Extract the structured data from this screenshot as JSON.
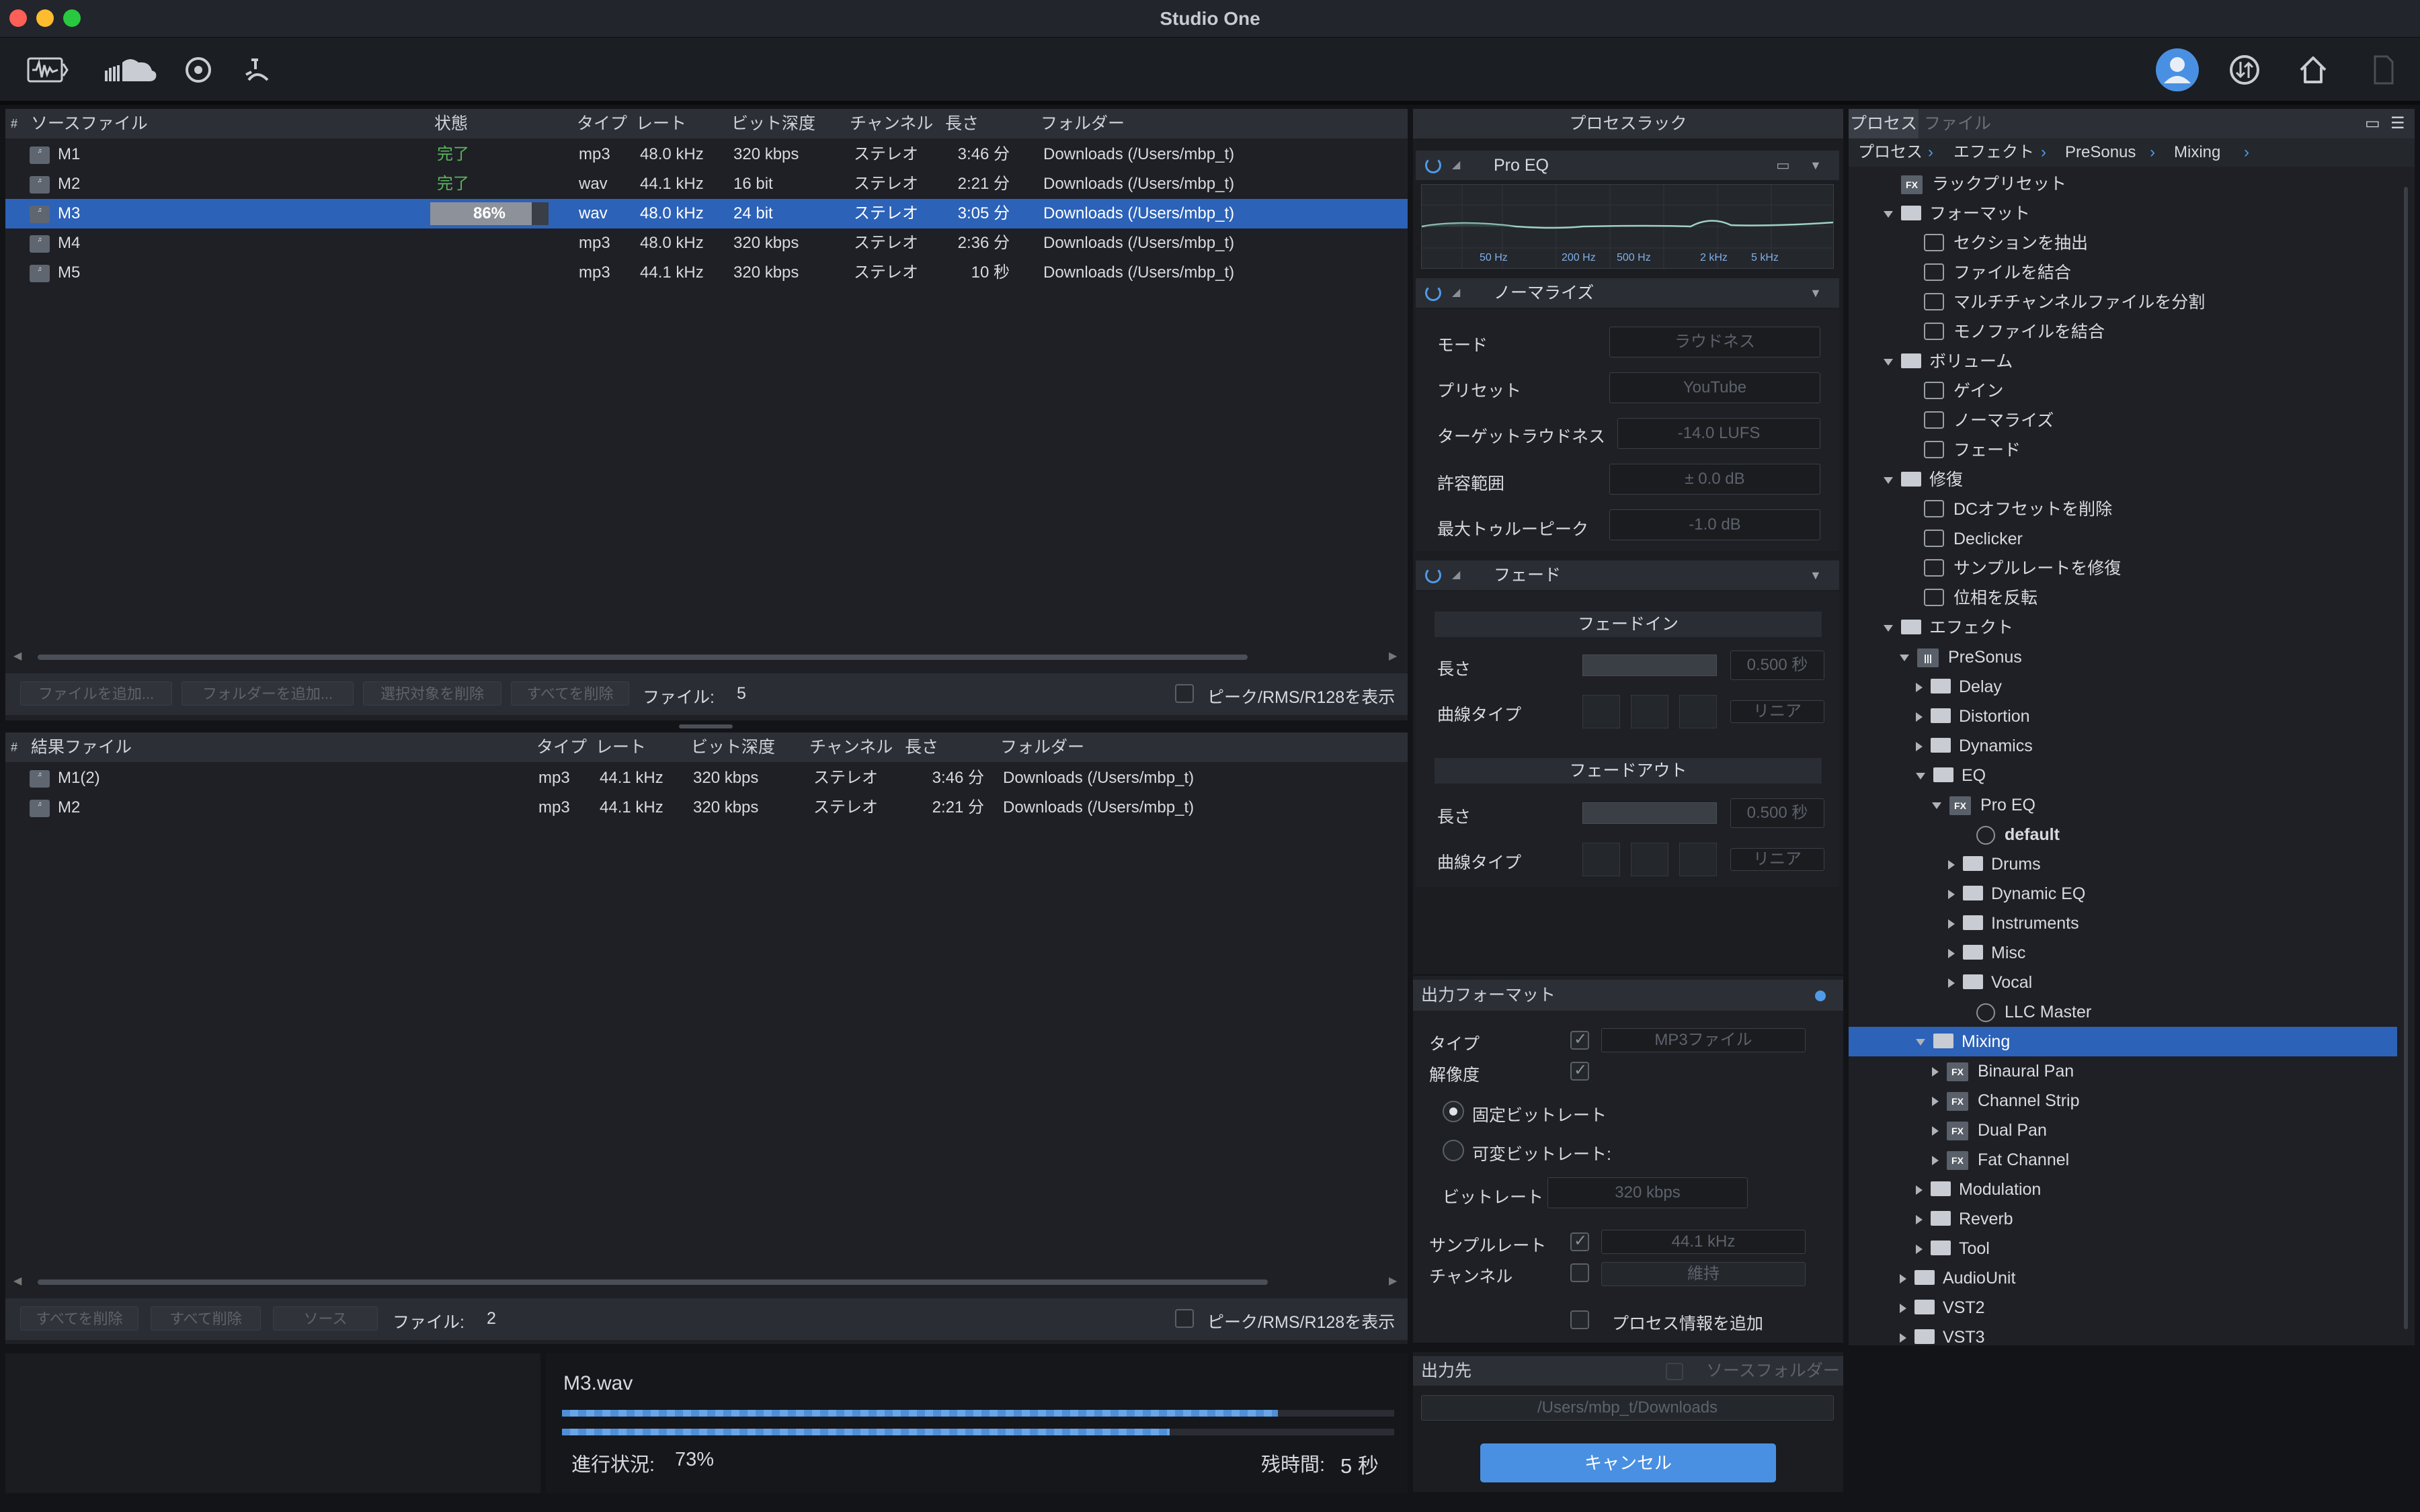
{
  "app": {
    "title": "Studio One"
  },
  "colors": {
    "accent": "#2c62b8",
    "done": "#5db55d",
    "progress": "#4f8fd8",
    "background": "#1e2025"
  },
  "toolbar": {
    "icons": [
      "waveform-browser-icon",
      "cloud-icon",
      "target-icon",
      "metronome-icon",
      "user-avatar-icon",
      "sync-icon",
      "home-icon",
      "document-icon"
    ]
  },
  "source": {
    "headers": {
      "num": "#",
      "file": "ソースファイル",
      "status": "状態",
      "type": "タイプ",
      "rate": "レート",
      "depth": "ビット深度",
      "channel": "チャンネル",
      "length": "長さ",
      "folder": "フォルダー"
    },
    "rows": [
      {
        "name": "M1",
        "status": "完了",
        "type": "mp3",
        "rate": "48.0 kHz",
        "depth": "320 kbps",
        "channel": "ステレオ",
        "length": "3:46 分",
        "folder": "Downloads  (/Users/mbp_t)"
      },
      {
        "name": "M2",
        "status": "完了",
        "type": "wav",
        "rate": "44.1 kHz",
        "depth": "16 bit",
        "channel": "ステレオ",
        "length": "2:21 分",
        "folder": "Downloads  (/Users/mbp_t)"
      },
      {
        "name": "M3",
        "status": "86%",
        "type": "wav",
        "rate": "48.0 kHz",
        "depth": "24 bit",
        "channel": "ステレオ",
        "length": "3:05 分",
        "folder": "Downloads  (/Users/mbp_t)"
      },
      {
        "name": "M4",
        "status": "",
        "type": "mp3",
        "rate": "48.0 kHz",
        "depth": "320 kbps",
        "channel": "ステレオ",
        "length": "2:36 分",
        "folder": "Downloads  (/Users/mbp_t)"
      },
      {
        "name": "M5",
        "status": "",
        "type": "mp3",
        "rate": "44.1 kHz",
        "depth": "320 kbps",
        "channel": "ステレオ",
        "length": "10 秒",
        "folder": "Downloads  (/Users/mbp_t)"
      }
    ],
    "selected_progress": 0.86,
    "buttons": {
      "add_file": "ファイルを追加...",
      "add_folder": "フォルダーを追加...",
      "remove_sel": "選択対象を削除",
      "remove_all": "すべてを削除"
    },
    "file_count_label": "ファイル:",
    "file_count": "5",
    "peak_label": "ピーク/RMS/R128を表示"
  },
  "result": {
    "headers": {
      "num": "#",
      "file": "結果ファイル",
      "type": "タイプ",
      "rate": "レート",
      "depth": "ビット深度",
      "channel": "チャンネル",
      "length": "長さ",
      "folder": "フォルダー"
    },
    "rows": [
      {
        "name": "M1(2)",
        "type": "mp3",
        "rate": "44.1 kHz",
        "depth": "320 kbps",
        "channel": "ステレオ",
        "length": "3:46 分",
        "folder": "Downloads  (/Users/mbp_t)"
      },
      {
        "name": "M2",
        "type": "mp3",
        "rate": "44.1 kHz",
        "depth": "320 kbps",
        "channel": "ステレオ",
        "length": "2:21 分",
        "folder": "Downloads  (/Users/mbp_t)"
      }
    ],
    "buttons": {
      "remove_all": "すべてを削除",
      "remove_all2": "すべて削除",
      "source": "ソース"
    },
    "file_count_label": "ファイル:",
    "file_count": "2",
    "peak_label": "ピーク/RMS/R128を表示"
  },
  "progress": {
    "file": "M3.wav",
    "status_label": "進行状況:",
    "status_value": "73%",
    "remaining_label": "残時間:",
    "remaining_value": "5 秒",
    "bar1": 0.86,
    "bar2": 0.73
  },
  "rack": {
    "title": "プロセスラック",
    "proeq": {
      "name": "Pro EQ",
      "freqs": [
        "50 Hz",
        "200 Hz",
        "500 Hz",
        "2 kHz",
        "5 kHz"
      ]
    },
    "normalize": {
      "name": "ノーマライズ",
      "mode_label": "モード",
      "mode": "ラウドネス",
      "preset_label": "プリセット",
      "preset": "YouTube",
      "target_label": "ターゲットラウドネス",
      "target": "-14.0 LUFS",
      "tolerance_label": "許容範囲",
      "tolerance": "± 0.0 dB",
      "peak_label": "最大トゥルーピーク",
      "peak": "-1.0 dB"
    },
    "fade": {
      "name": "フェード",
      "fadein": "フェードイン",
      "fadeout": "フェードアウト",
      "length_label": "長さ",
      "length_in": "0.500 秒",
      "length_out": "0.500 秒",
      "curve_label": "曲線タイプ",
      "curve_in": "リニア",
      "curve_out": "リニア"
    }
  },
  "output": {
    "title": "出力フォーマット",
    "type_label": "タイプ",
    "type": "MP3ファイル",
    "res_label": "解像度",
    "cbr": "固定ビットレート",
    "vbr": "可変ビットレート:",
    "bitrate_label": "ビットレート",
    "bitrate": "320 kbps",
    "samplerate_label": "サンプルレート",
    "samplerate": "44.1 kHz",
    "channel_label": "チャンネル",
    "channel": "維持",
    "addinfo": "プロセス情報を追加",
    "dest_title": "出力先",
    "source_folder": "ソースフォルダー",
    "dest_path": "/Users/mbp_t/Downloads",
    "cancel": "キャンセル"
  },
  "browser": {
    "tab_process": "プロセス",
    "tab_file": "ファイル",
    "breadcrumb": [
      "プロセス",
      "エフェクト",
      "PreSonus",
      "Mixing"
    ],
    "items": [
      {
        "label": "ラックプリセット"
      },
      {
        "label": "フォーマット"
      },
      {
        "label": "セクションを抽出"
      },
      {
        "label": "ファイルを結合"
      },
      {
        "label": "マルチチャンネルファイルを分割"
      },
      {
        "label": "モノファイルを結合"
      },
      {
        "label": "ボリューム"
      },
      {
        "label": "ゲイン"
      },
      {
        "label": "ノーマライズ"
      },
      {
        "label": "フェード"
      },
      {
        "label": "修復"
      },
      {
        "label": "DCオフセットを削除"
      },
      {
        "label": "Declicker"
      },
      {
        "label": "サンプルレートを修復"
      },
      {
        "label": "位相を反転"
      },
      {
        "label": "エフェクト"
      },
      {
        "label": "PreSonus"
      },
      {
        "label": "Delay"
      },
      {
        "label": "Distortion"
      },
      {
        "label": "Dynamics"
      },
      {
        "label": "EQ"
      },
      {
        "label": "Pro EQ"
      },
      {
        "label": "default"
      },
      {
        "label": "Drums"
      },
      {
        "label": "Dynamic EQ"
      },
      {
        "label": "Instruments"
      },
      {
        "label": "Misc"
      },
      {
        "label": "Vocal"
      },
      {
        "label": "LLC Master"
      },
      {
        "label": "Mixing"
      },
      {
        "label": "Binaural Pan"
      },
      {
        "label": "Channel Strip"
      },
      {
        "label": "Dual Pan"
      },
      {
        "label": "Fat Channel"
      },
      {
        "label": "Modulation"
      },
      {
        "label": "Reverb"
      },
      {
        "label": "Tool"
      },
      {
        "label": "AudioUnit"
      },
      {
        "label": "VST2"
      },
      {
        "label": "VST3"
      }
    ]
  }
}
